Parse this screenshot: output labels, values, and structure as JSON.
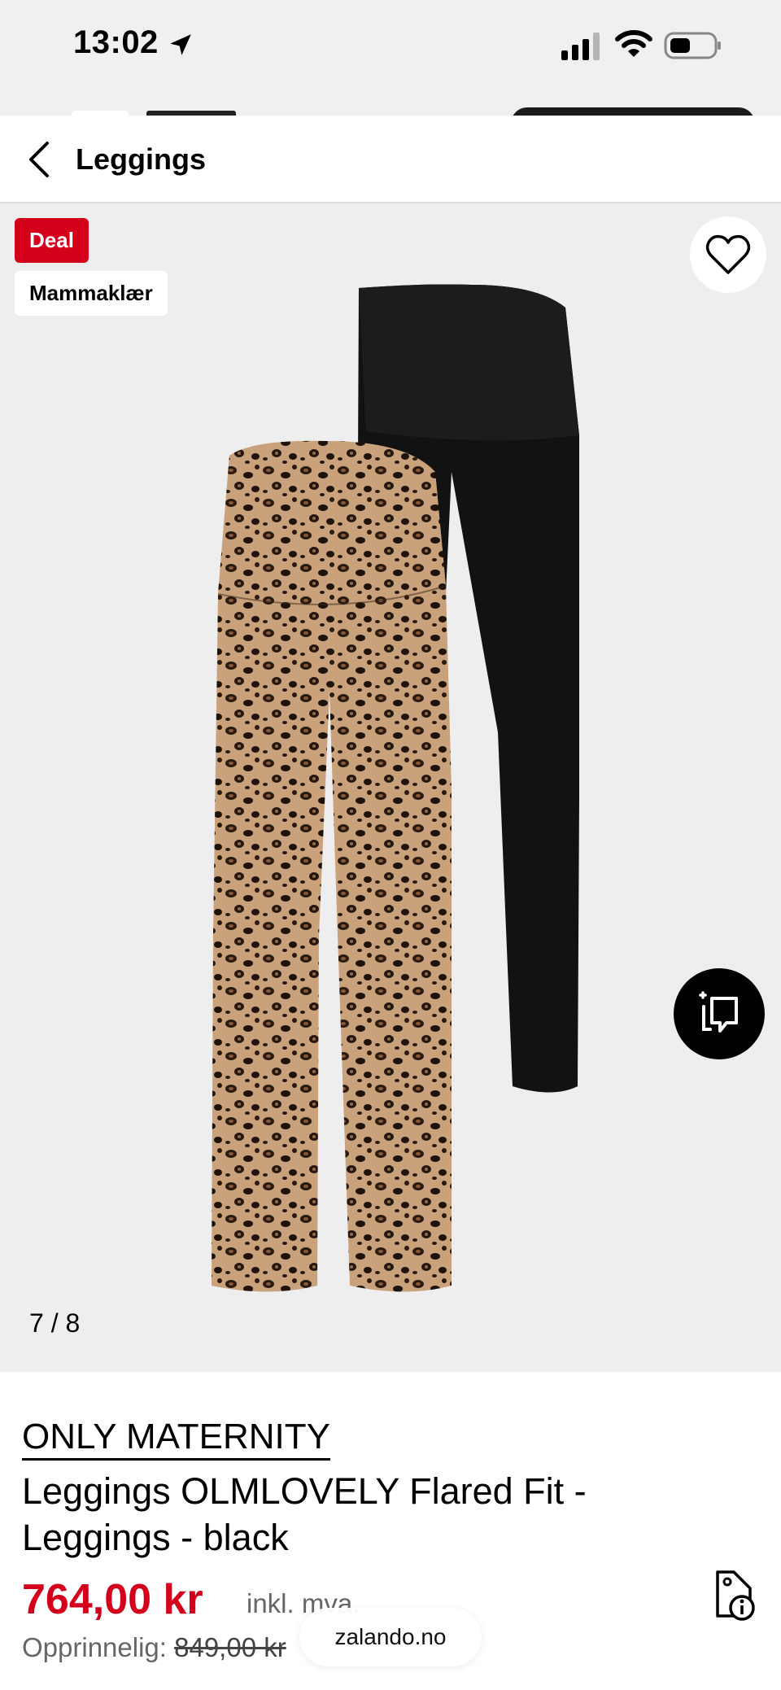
{
  "status_bar": {
    "time": "13:02"
  },
  "header": {
    "title": "Leggings"
  },
  "gallery": {
    "badges": {
      "deal": "Deal",
      "category": "Mammaklær"
    },
    "counter": "7 / 8"
  },
  "product": {
    "brand": "ONLY MATERNITY",
    "name": "Leggings OLMLOVELY Flared Fit - Leggings - black",
    "price": "764,00 kr",
    "vat": "inkl. mva.",
    "original_label": "Opprinnelig:",
    "original_price": "849,00 kr"
  },
  "browser": {
    "url": "zalando.no"
  },
  "colors": {
    "sale_red": "#d4001b",
    "gallery_bg": "#eeeeee"
  },
  "icons": [
    "location-arrow-icon",
    "signal-icon",
    "wifi-icon",
    "battery-icon",
    "back-chevron-icon",
    "heart-icon",
    "similar-items-icon",
    "price-info-icon"
  ]
}
